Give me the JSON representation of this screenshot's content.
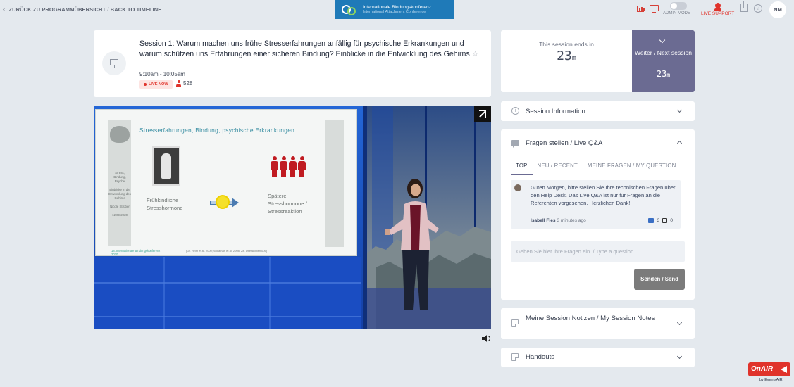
{
  "topbar": {
    "back_label": "ZURÜCK ZU PROGRAMMÜBERSICHT / BACK TO TIMELINE",
    "brand_line1": "Internationale Bindungskonferenz",
    "brand_line2": "International Attachment Conference",
    "admin_mode_label": "ADMIN MODE",
    "admin_mode_on": false,
    "live_support_label": "LIVE SUPPORT",
    "avatar_initials": "NM",
    "accent_color": "#e0332b"
  },
  "session": {
    "title": "Session 1: Warum machen uns frühe Stresserfahrungen anfällig für psychische Erkrankungen und warum schützen uns Erfahrungen einer sicheren Bindung? Einblicke in die Entwicklung des Gehirns",
    "time": "9:10am - 10:05am",
    "live_label": "LIVE NOW",
    "viewers": "528"
  },
  "slide": {
    "title": "Stresserfahrungen, Bindung, psychische Erkrankungen",
    "side_text": "Stress, Bindung, Psyche\n\nEinblicke in die Entwicklung des Gehirns\n\nNicole Strüber\n\n12.09.2020",
    "early_label": "Frühkindliche Stresshormone",
    "late_label": "Spätere Stresshormone / Stressreaktion",
    "footer_left": "18. Internationale Bindungskonferenz 2020",
    "footer_refs": "(Lit. Heim et al. 2000; Widaman et al. 2008; Zit. Übersichten u.a.)"
  },
  "timer": {
    "ends_label": "This session ends in",
    "ends_value": "23",
    "ends_unit": "m",
    "next_label": "Weiter / Next session",
    "next_value": "23",
    "next_unit": "m",
    "next_color": "#6b6b92"
  },
  "panels": {
    "info_title": "Session Information",
    "qa_title": "Fragen stellen / Live Q&A",
    "qa_tabs": [
      "TOP",
      "NEU / RECENT",
      "MEINE FRAGEN / MY QUESTION"
    ],
    "qa_active_tab": "TOP",
    "qa_message": "Guten Morgen, bitte stellen Sie Ihre technischen Fragen über den Help Desk. Das Live Q&A ist nur für Fragen an die Referenten vorgesehen. Herzlichen Dank!",
    "qa_author": "Isabell Fies",
    "qa_time": "3 minutes ago",
    "qa_upvotes": "3",
    "qa_downvotes": "0",
    "qa_placeholder": "Geben Sie hier Ihre Fragen ein  / Type a question",
    "send_label": "Senden / Send",
    "notes_title": "Meine Session Notizen / My Session Notes",
    "handouts_title": "Handouts"
  },
  "footer": {
    "onair_label": "OnAIR",
    "onair_sub": "by EventsAIR"
  }
}
